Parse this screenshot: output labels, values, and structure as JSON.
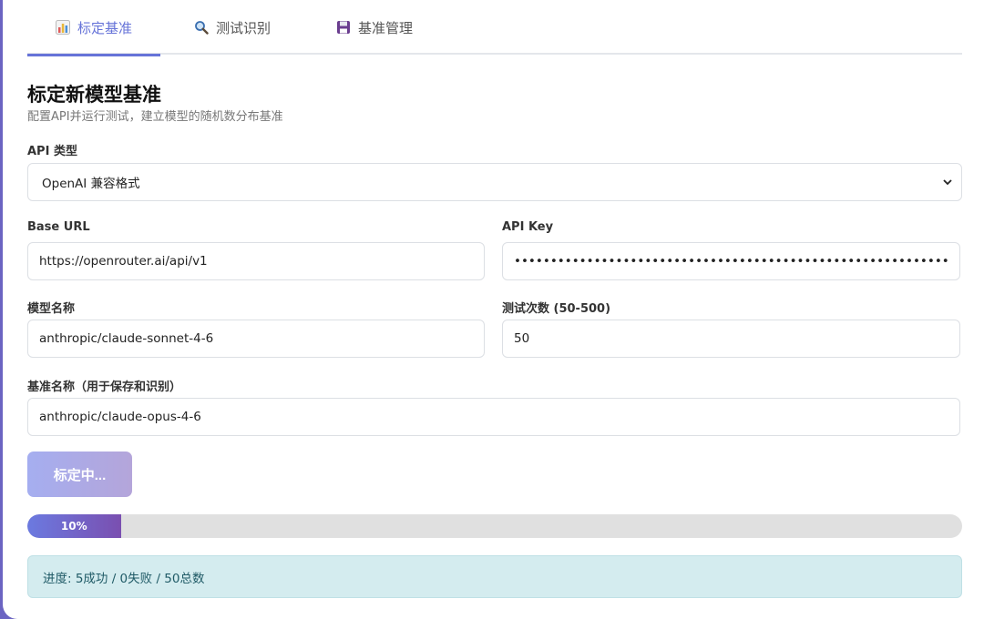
{
  "tabs": [
    {
      "label": "标定基准",
      "icon": "bar-chart-icon",
      "active": true
    },
    {
      "label": "测试识别",
      "icon": "magnifier-icon",
      "active": false
    },
    {
      "label": "基准管理",
      "icon": "floppy-disk-icon",
      "active": false
    }
  ],
  "header": {
    "title": "标定新模型基准",
    "subtitle": "配置API并运行测试，建立模型的随机数分布基准"
  },
  "form": {
    "api_type_label": "API 类型",
    "api_type_value": "OpenAI 兼容格式",
    "base_url_label": "Base URL",
    "base_url_value": "https://openrouter.ai/api/v1",
    "api_key_label": "API Key",
    "api_key_value": "sk-or-v1-0000000000000000000000000000000000000000000000000000000000000000",
    "model_label": "模型名称",
    "model_value": "anthropic/claude-sonnet-4-6",
    "count_label": "测试次数 (50-500)",
    "count_value": "50",
    "baseline_label": "基准名称（用于保存和识别）",
    "baseline_value": "anthropic/claude-opus-4-6"
  },
  "action": {
    "button_label": "标定中..."
  },
  "progress": {
    "fraction": 0.1,
    "label": "10%"
  },
  "status": {
    "text": "进度: 5成功 / 0失败 / 50总数"
  },
  "colors": {
    "accent": "#6673d8",
    "progress_start": "#6b7ae0",
    "progress_end": "#7a4fb0",
    "status_bg": "#d4ecef"
  }
}
